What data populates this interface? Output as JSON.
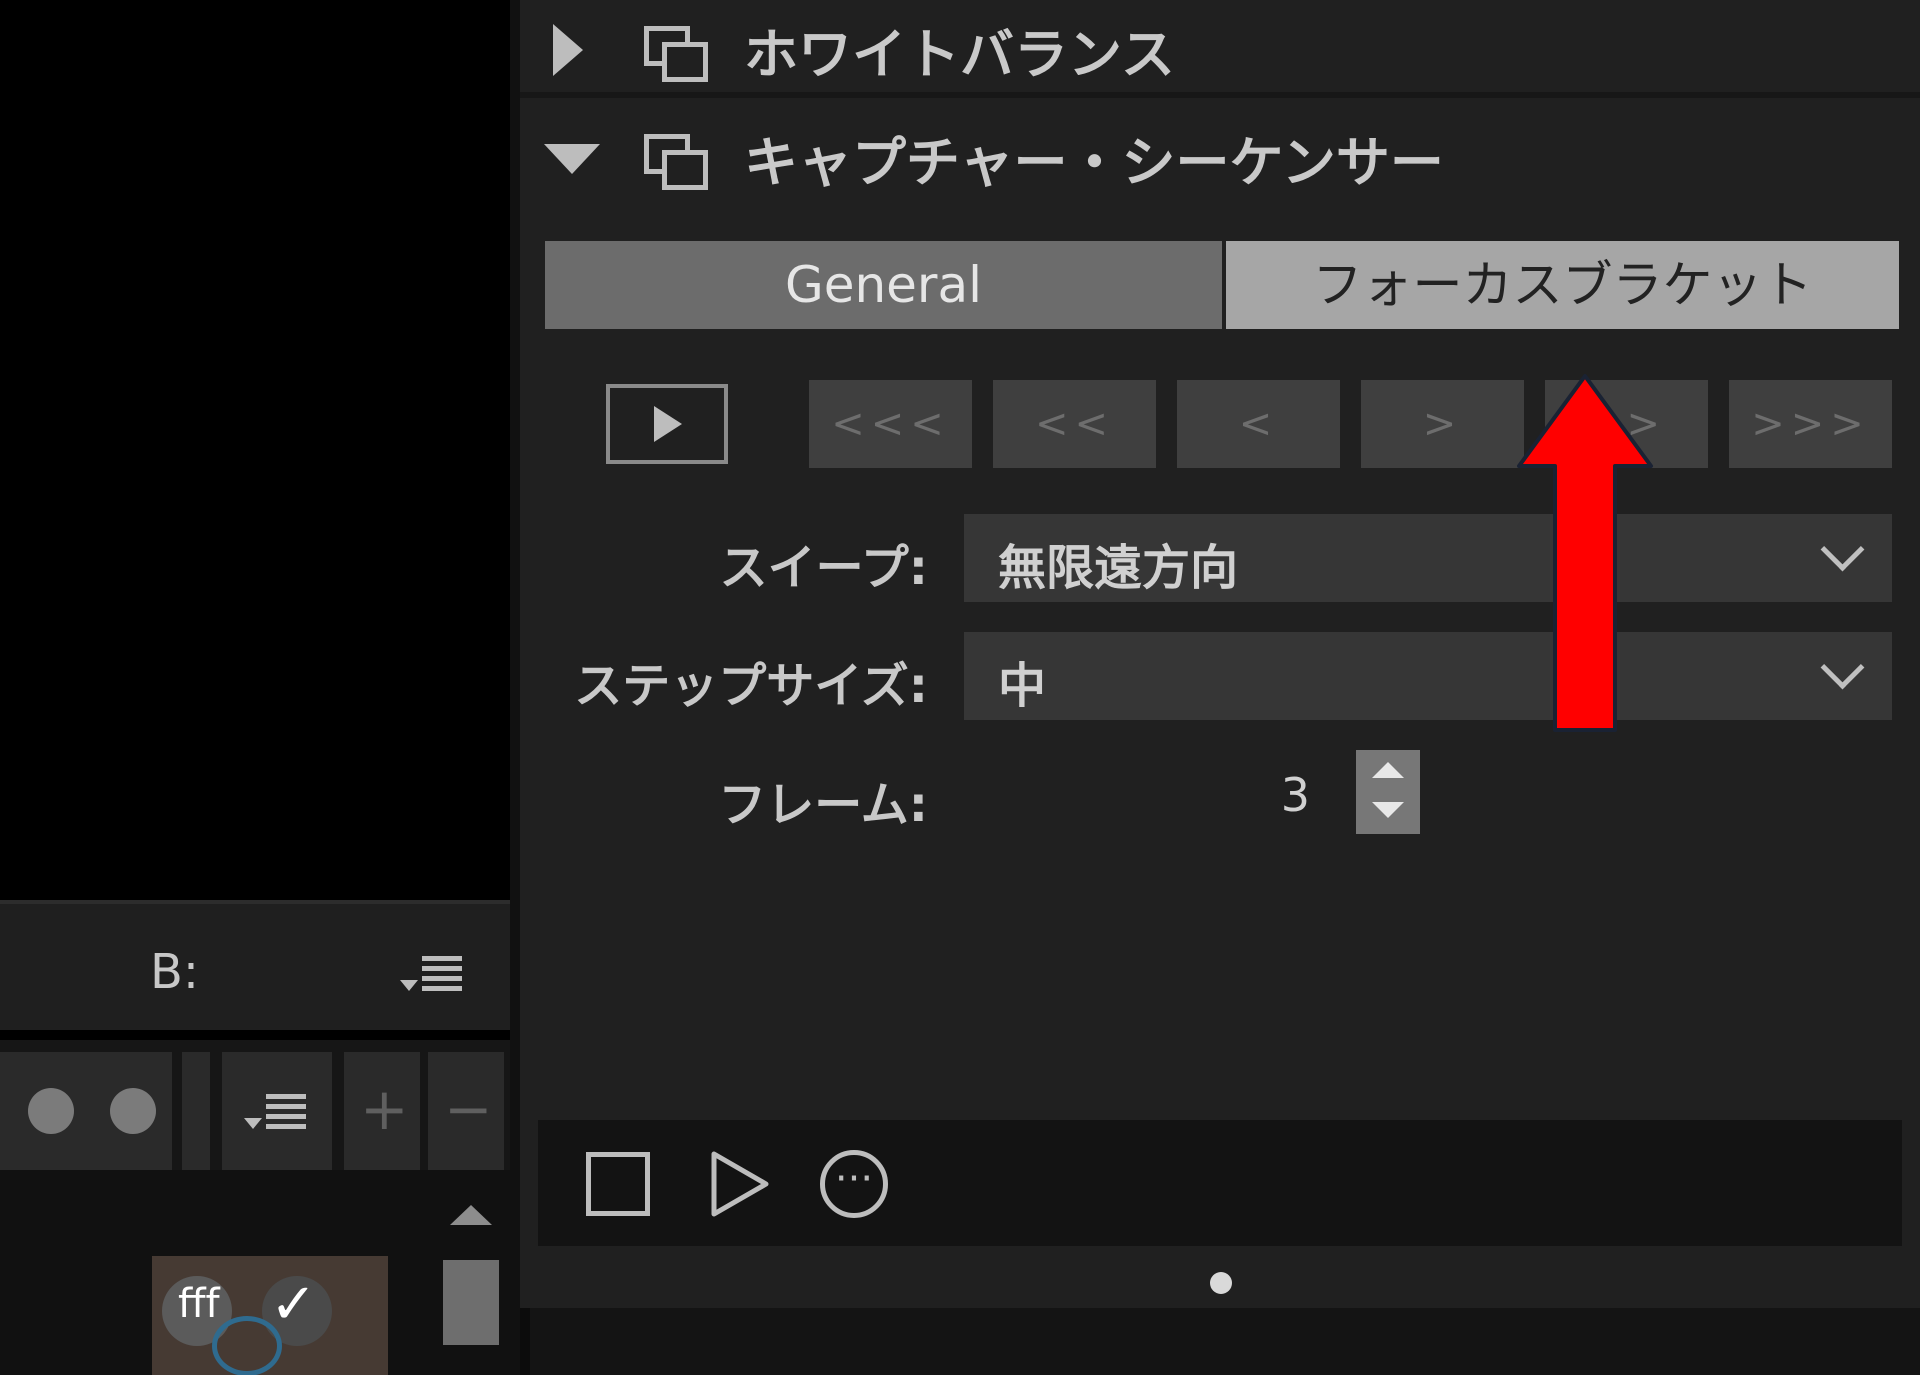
{
  "left": {
    "b_label": "B:",
    "thumbnail": {
      "text": "fff",
      "check": "✓"
    },
    "tools": {
      "plus": "+",
      "minus": "−"
    }
  },
  "sections": [
    {
      "title": "ホワイトバランス",
      "expanded": false
    },
    {
      "title": "キャプチャー・シーケンサー",
      "expanded": true
    }
  ],
  "tabs": {
    "general": "General",
    "focus_bracket": "フォーカスブラケット",
    "active": "フォーカスブラケット"
  },
  "nav_buttons": [
    "<<<",
    "<<",
    "<",
    ">",
    ">>",
    ">>>"
  ],
  "fields": {
    "sweep_label": "スイープ:",
    "sweep_value": "無限遠方向",
    "step_label": "ステップサイズ:",
    "step_value": "中",
    "frames_label": "フレーム:",
    "frames_value": "3"
  },
  "icons": {
    "section_toggle": "triangle-icon",
    "section_panel": "panel-copy-icon",
    "list_menu": "list-menu-icon",
    "play": "play-icon",
    "stop": "stop-icon",
    "more": "more-icon",
    "stepper": "stepper-icon"
  },
  "colors": {
    "annotation_arrow": "#ff0000",
    "panel_bg": "#202020",
    "tab_active": "#a6a6a6",
    "tab_inactive": "#6c6c6c"
  }
}
